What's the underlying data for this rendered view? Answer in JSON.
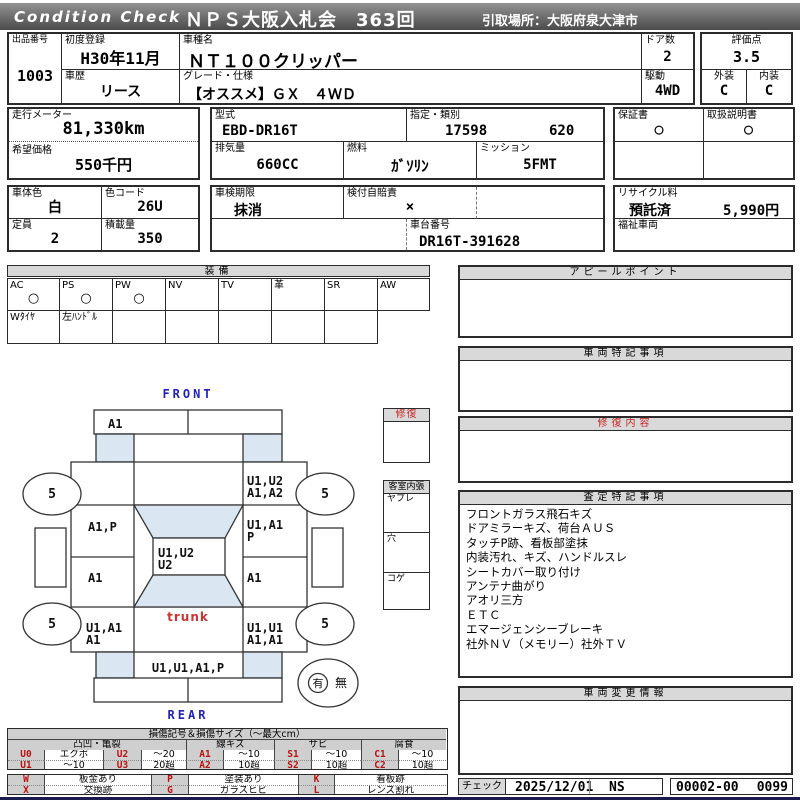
{
  "header": {
    "logo": "Condition  Check",
    "title": "ＮＰＳ大阪入札会　363回",
    "pickup": "引取場所：大阪府泉大津市"
  },
  "vehicle": {
    "lot_label": "出品番号",
    "lot_no": "1003",
    "first_reg_label": "初度登録",
    "first_reg": "H30年11月",
    "model_name_label": "車種名",
    "model_name": "ＮＴ１００クリッパー",
    "doors_label": "ドア数",
    "doors": "2",
    "score_label": "評価点",
    "score": "3.5",
    "history_label": "車歴",
    "history": "リース",
    "grade_label": "グレード・仕様",
    "grade": "【オススメ】ＧＸ　４ＷＤ",
    "drive_label": "駆動",
    "drive": "4WD",
    "exterior_label": "外装",
    "exterior": "C",
    "interior_label": "内装",
    "interior": "C"
  },
  "specs": {
    "odometer_label": "走行メーター",
    "odometer": "81,330km",
    "price_label": "希望価格",
    "price": "550千円",
    "model_code_label": "型式",
    "model_code": "EBD-DR16T",
    "class_label": "指定・類別",
    "class_no1": "17598",
    "class_no2": "620",
    "displacement_label": "排気量",
    "displacement": "660CC",
    "fuel_label": "燃料",
    "fuel": "ｶﾞｿﾘﾝ",
    "transmission_label": "ミッション",
    "transmission": "5FMT",
    "warranty_label": "保証書",
    "warranty": "○",
    "manual_label": "取扱説明書",
    "manual": "○",
    "color_label": "車体色",
    "color": "白",
    "color_code_label": "色コード",
    "color_code": "26U",
    "inspection_label": "車検期限",
    "inspection": "抹消",
    "insurance_label": "検付自賠責",
    "insurance": "×",
    "chassis_label": "車台番号",
    "chassis_no": "DR16T-391628",
    "recycle_label": "リサイクル料",
    "recycle_status": "預託済",
    "recycle_fee": "5,990円",
    "welfare_label": "福祉車両",
    "capacity_label": "定員",
    "capacity": "2",
    "load_label": "積載量",
    "load": "350"
  },
  "equipment": {
    "title": "装備",
    "columns": [
      {
        "label": "AC",
        "mark": "○"
      },
      {
        "label": "PS",
        "mark": "○"
      },
      {
        "label": "PW",
        "mark": "○"
      },
      {
        "label": "NV",
        "mark": ""
      },
      {
        "label": "TV",
        "mark": ""
      },
      {
        "label": "革",
        "mark": ""
      },
      {
        "label": "SR",
        "mark": ""
      },
      {
        "label": "AW",
        "mark": ""
      }
    ],
    "notes": [
      "Wﾀｲﾔ",
      "左ﾊﾝﾄﾞﾙ",
      "",
      "",
      "",
      "",
      ""
    ]
  },
  "diagram": {
    "front_label": "FRONT",
    "rear_label": "REAR",
    "hood": "A1",
    "fender_right_l1": "U1,U2",
    "fender_right_l2": "A1,A2",
    "door_left": "A1,P",
    "door_right_l1": "U1,A1",
    "door_right_l2": "P",
    "roof_l1": "U1,U2",
    "roof_l2": "U2",
    "quarter_left": "A1",
    "quarter_right": "A1",
    "bed_left_l1": "U1,A1",
    "bed_left_l2": "A1",
    "bed_center": "trunk",
    "bed_right_l1": "U1,U1",
    "bed_right_l2": "A1,A1",
    "rear_panel": "U1,U1,A1,P",
    "wheel_fl": "5",
    "wheel_fr": "5",
    "wheel_rl": "5",
    "wheel_rr": "5",
    "spare_yes": "有",
    "spare_no": "無"
  },
  "repair_box": {
    "title": "修復"
  },
  "interior_box": {
    "title": "客室内張",
    "item1": "ヤブレ",
    "item2": "穴",
    "item3": "コゲ"
  },
  "sections": {
    "appeal": {
      "title": "アピールポイント"
    },
    "vehicle_notes": {
      "title": "車両特記事項"
    },
    "repair_details": {
      "title": "修復内容"
    },
    "assessment": {
      "title": "査定特記事項",
      "lines": [
        "フロントガラス飛石キズ",
        "ドアミラーキズ、荷台ＡＵＳ",
        "タッチP跡、看板部塗抹",
        "内装汚れ、キズ、ハンドルスレ",
        "シートカバー取り付け",
        "アンテナ曲がり",
        "アオリ三方",
        "ＥＴＣ",
        "エマージェンシーブレーキ",
        "社外ＮＶ（メモリー）社外ＴＶ"
      ]
    },
    "change_info": {
      "title": "車両変更情報"
    }
  },
  "check": {
    "label": "チェック",
    "date": "2025/12/01",
    "inspector": "NS",
    "code1": "00002-00",
    "code2": "0099"
  },
  "legend": {
    "title": "損傷記号＆損傷サイズ（～最大cm）",
    "groups": [
      "凸凹・亀裂",
      "線キズ",
      "サビ",
      "腐食"
    ],
    "size_rows": [
      [
        {
          "code": "U0",
          "desc": "エクボ"
        },
        {
          "code": "U2",
          "desc": "～20"
        },
        {
          "code": "A1",
          "desc": "～10"
        },
        {
          "code": "S1",
          "desc": "～10"
        },
        {
          "code": "C1",
          "desc": "～10"
        }
      ],
      [
        {
          "code": "U1",
          "desc": "～10"
        },
        {
          "code": "U3",
          "desc": "20超"
        },
        {
          "code": "A2",
          "desc": "10超"
        },
        {
          "code": "S2",
          "desc": "10超"
        },
        {
          "code": "C2",
          "desc": "10超"
        }
      ]
    ],
    "mark_rows": [
      [
        {
          "code": "W",
          "desc": "板金あり"
        },
        {
          "code": "P",
          "desc": "塗装あり"
        },
        {
          "code": "K",
          "desc": "看板跡"
        }
      ],
      [
        {
          "code": "X",
          "desc": "交換跡"
        },
        {
          "code": "G",
          "desc": "ガラスヒビ"
        },
        {
          "code": "L",
          "desc": "レンズ割れ"
        }
      ]
    ]
  },
  "colors": {
    "accent_blue": "#2222bb",
    "damage_red": "#cc2222",
    "glass_blue": "#dbe6f3",
    "header_gray": "#d9d9d9"
  }
}
